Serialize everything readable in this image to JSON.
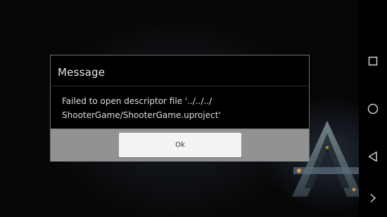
{
  "dialog": {
    "title": "Message",
    "message_line1": "Failed to open descriptor file '../../../",
    "message_line2": "ShooterGame/ShooterGame.uproject'",
    "ok_label": "Ok"
  },
  "nav_bar": {
    "buttons": [
      "recent-apps",
      "home",
      "back",
      "next"
    ]
  },
  "colors": {
    "dialog_background": "#000000",
    "dialog_footer": "#929292",
    "button_background": "#f3f3f3",
    "nav_icon": "#cfcfcf"
  }
}
